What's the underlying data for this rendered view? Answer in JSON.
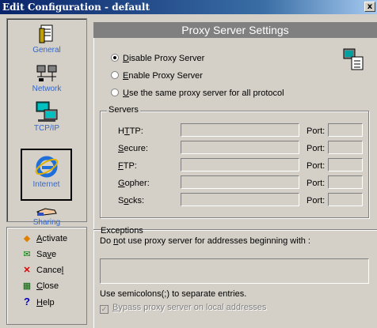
{
  "window": {
    "title": "Edit Configuration - default",
    "close_glyph": "x"
  },
  "sidebar": {
    "items": [
      {
        "label": "General",
        "icon": "document-icon"
      },
      {
        "label": "Network",
        "icon": "network-icon"
      },
      {
        "label": "TCP/IP",
        "icon": "computers-icon"
      },
      {
        "label": "Internet",
        "icon": "internet-explorer-icon",
        "selected": true
      },
      {
        "label": "Sharing",
        "icon": "sharing-hand-icon"
      }
    ]
  },
  "actions": {
    "activate": {
      "pre": "",
      "u": "A",
      "post": "ctivate"
    },
    "save": {
      "pre": "Sa",
      "u": "v",
      "post": "e"
    },
    "cancel": {
      "pre": "Cance",
      "u": "l",
      "post": ""
    },
    "close": {
      "pre": "",
      "u": "C",
      "post": "lose"
    },
    "help": {
      "pre": "",
      "u": "H",
      "post": "elp"
    }
  },
  "panel": {
    "title": "Proxy Server Settings",
    "radios": {
      "disable": {
        "u": "D",
        "post": "isable Proxy Server",
        "checked": true
      },
      "enable": {
        "u": "E",
        "post": "nable Proxy Server",
        "checked": false
      },
      "same": {
        "u": "U",
        "post": "se the same proxy server for all protocol",
        "checked": false
      }
    },
    "servers": {
      "legend": "Servers",
      "port_label": "Port:",
      "rows": {
        "http": {
          "pre": "H",
          "u": "T",
          "post": "TP:"
        },
        "secure": {
          "pre": "",
          "u": "S",
          "post": "ecure:"
        },
        "ftp": {
          "pre": "",
          "u": "F",
          "post": "TP:"
        },
        "gopher": {
          "pre": "",
          "u": "G",
          "post": "opher:"
        },
        "socks": {
          "pre": "S",
          "u": "o",
          "post": "cks:"
        }
      }
    },
    "exceptions": {
      "legend": "Exceptions",
      "desc_pre": "Do ",
      "desc_u": "n",
      "desc_post": "ot use proxy server for addresses beginning with :",
      "hint": "Use semicolons(;) to separate entries.",
      "bypass_u": "B",
      "bypass_post": "ypass proxy server on local addresses",
      "bypass_checked": true
    }
  }
}
